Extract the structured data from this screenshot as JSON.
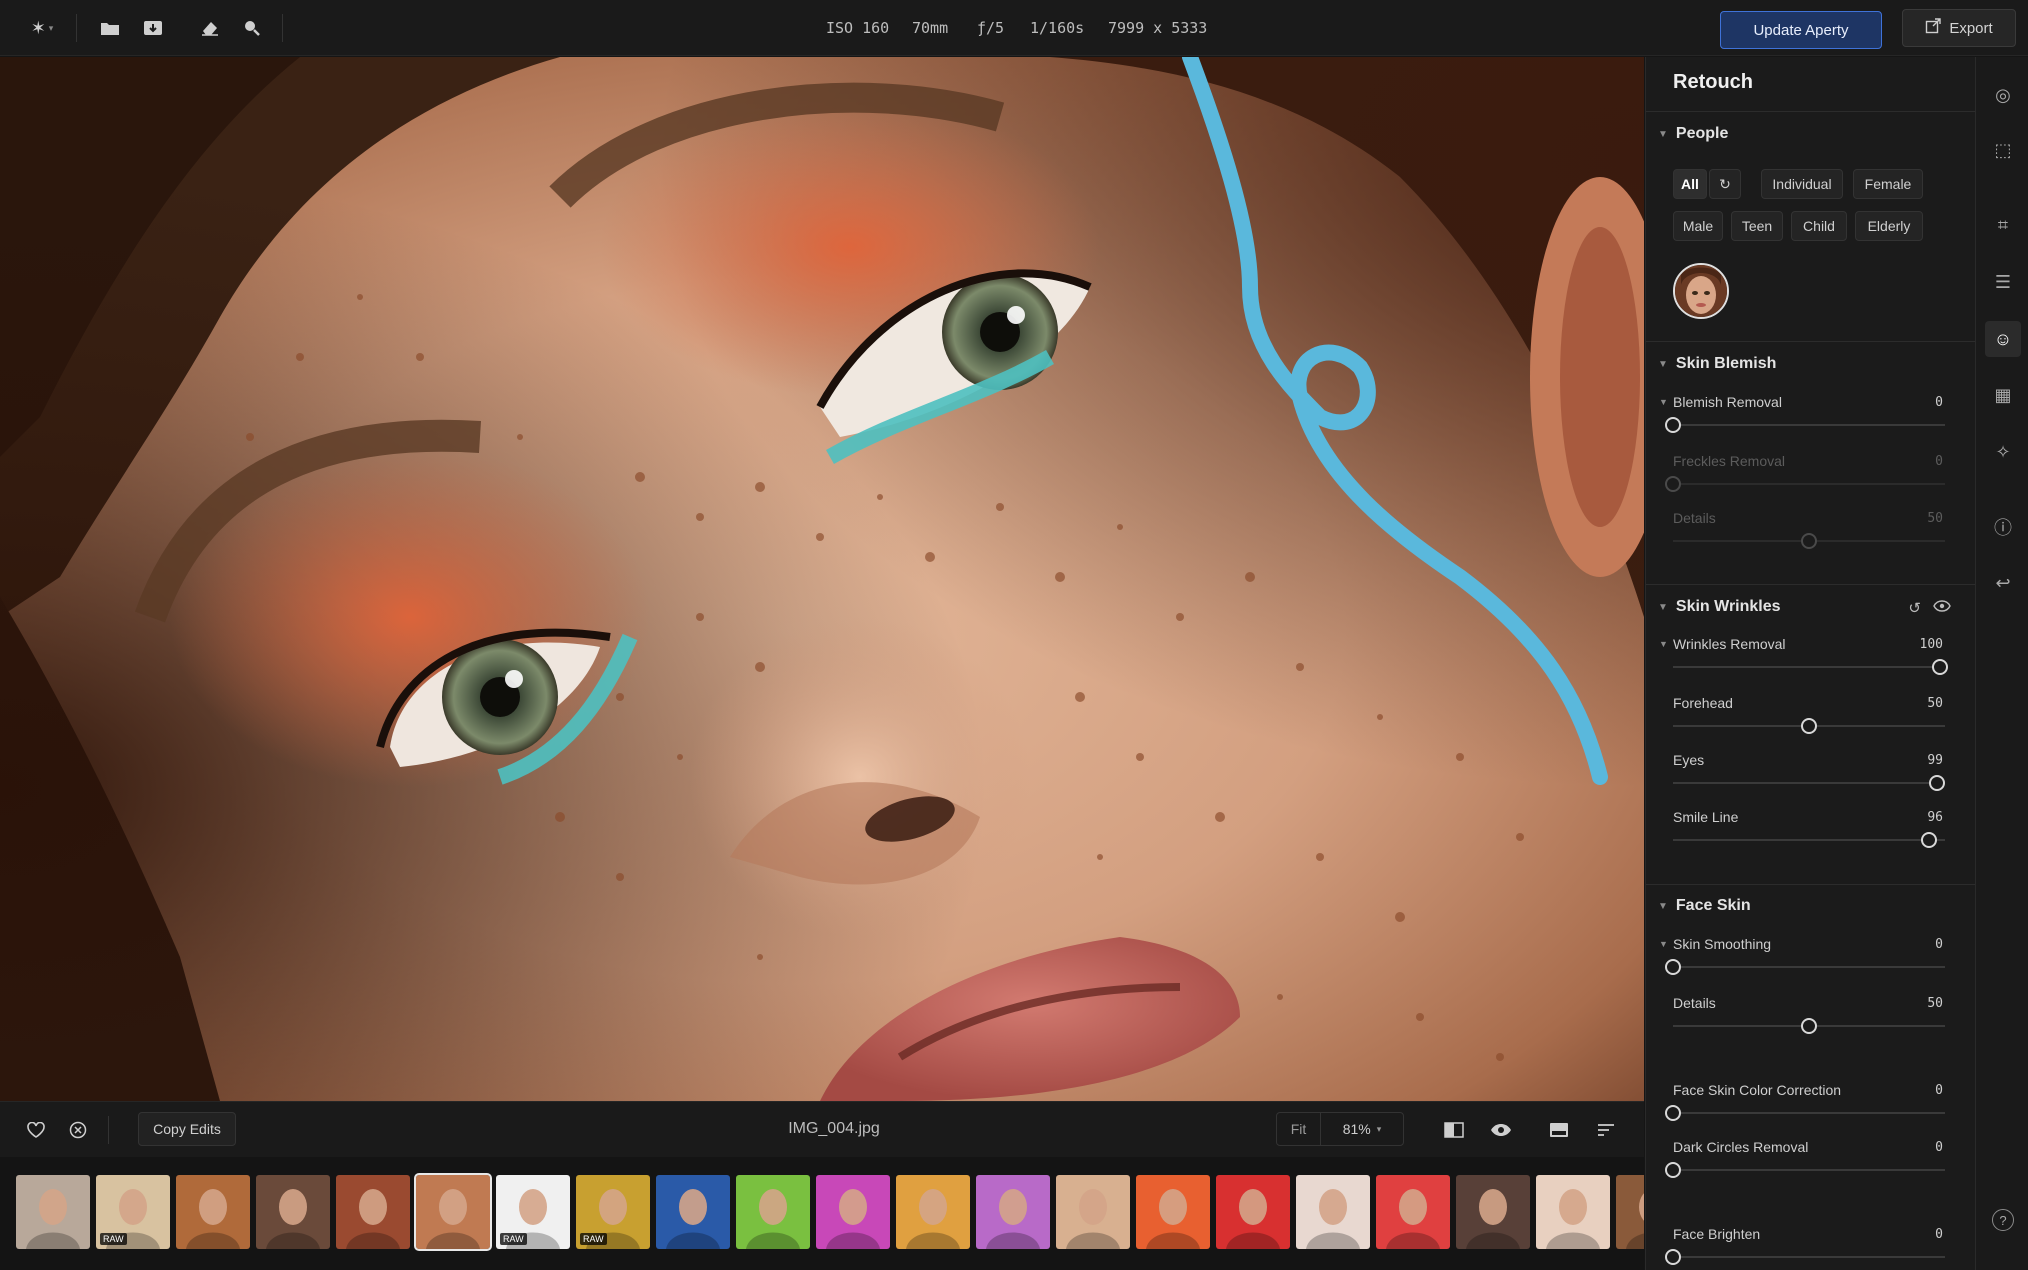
{
  "toolbar": {
    "logo_icon": "aperty-star-icon",
    "icons": [
      "folder-icon",
      "import-icon",
      "eraser-icon",
      "zoom-icon"
    ],
    "meta": {
      "iso": "ISO 160",
      "focal": "70mm",
      "aperture": "ƒ/5",
      "shutter": "1/160s",
      "dimensions": "7999 x 5333"
    },
    "update_label": "Update Aperty",
    "export_label": "Export"
  },
  "bottombar": {
    "copy_label": "Copy Edits",
    "filename": "IMG_004.jpg",
    "fit_label": "Fit",
    "zoom_value": "81%"
  },
  "filmstrip": {
    "raw_badge": "RAW",
    "thumbs": [
      {
        "color": "#b8a89a",
        "raw": false
      },
      {
        "color": "#d8c2a0",
        "raw": true
      },
      {
        "color": "#b06a3a",
        "raw": false
      },
      {
        "color": "#6a4a3a",
        "raw": false
      },
      {
        "color": "#9a4a30",
        "raw": false
      },
      {
        "color": "#c07a52",
        "raw": false,
        "selected": true
      },
      {
        "color": "#f0f0f0",
        "raw": true
      },
      {
        "color": "#c8a030",
        "raw": true
      },
      {
        "color": "#2a5aa8",
        "raw": false
      },
      {
        "color": "#7ac040",
        "raw": false
      },
      {
        "color": "#c848b8",
        "raw": false
      },
      {
        "color": "#e0a040",
        "raw": false
      },
      {
        "color": "#b86ac8",
        "raw": false
      },
      {
        "color": "#d8b090",
        "raw": false
      },
      {
        "color": "#e86030",
        "raw": false
      },
      {
        "color": "#d83030",
        "raw": false
      },
      {
        "color": "#e8d8d0",
        "raw": false
      },
      {
        "color": "#e04040",
        "raw": false
      },
      {
        "color": "#584038",
        "raw": false
      },
      {
        "color": "#e8d0c0",
        "raw": false
      },
      {
        "color": "#8a5a3a",
        "raw": false
      }
    ]
  },
  "panel": {
    "title": "Retouch",
    "people": {
      "heading": "People",
      "chips_row1": [
        "All",
        "Individual",
        "Female"
      ],
      "chips_row2": [
        "Male",
        "Teen",
        "Child",
        "Elderly"
      ]
    },
    "skin_blemish": {
      "heading": "Skin Blemish",
      "sliders": [
        {
          "label": "Blemish Removal",
          "value": "0",
          "level": 0,
          "dim": false
        },
        {
          "label": "Freckles Removal",
          "value": "0",
          "level": 0,
          "dim": true
        },
        {
          "label": "Details",
          "value": "50",
          "level": 0.5,
          "dim": true
        }
      ]
    },
    "skin_wrinkles": {
      "heading": "Skin Wrinkles",
      "sliders": [
        {
          "label": "Wrinkles Removal",
          "value": "100",
          "level": 0.98
        },
        {
          "label": "Forehead",
          "value": "50",
          "level": 0.5
        },
        {
          "label": "Eyes",
          "value": "99",
          "level": 0.97
        },
        {
          "label": "Smile Line",
          "value": "96",
          "level": 0.94
        }
      ]
    },
    "face_skin": {
      "heading": "Face Skin",
      "sliders": [
        {
          "label": "Skin Smoothing",
          "value": "0",
          "level": 0
        },
        {
          "label": "Details",
          "value": "50",
          "level": 0.5
        },
        {
          "label": "Face Skin Color Correction",
          "value": "0",
          "level": 0
        },
        {
          "label": "Dark Circles Removal",
          "value": "0",
          "level": 0
        },
        {
          "label": "Face Brighten",
          "value": "0",
          "level": 0
        }
      ]
    }
  },
  "rail": {
    "icons": [
      "presets-icon",
      "select-icon",
      "crop-icon",
      "adjust-icon",
      "retouch-icon",
      "layers-icon",
      "ai-sparkle-icon",
      "info-icon",
      "undo-history-icon",
      "help-icon"
    ]
  },
  "colors": {
    "accent": "#3f72d8",
    "panel": "#1b1b1b",
    "bar": "#1a1a1a"
  }
}
